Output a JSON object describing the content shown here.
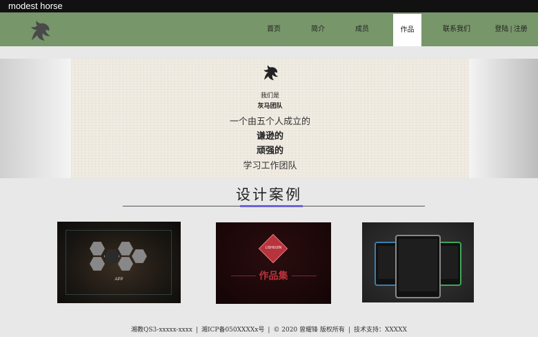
{
  "topbar": {
    "brand": "modest horse"
  },
  "nav": {
    "items": [
      "首页",
      "简介",
      "成员",
      "作品",
      "联系我们"
    ],
    "active": "作品",
    "login": "登陆",
    "sep": "|",
    "register": "注册"
  },
  "banner": {
    "line1": "我们是",
    "line2": "灰马团队",
    "line3": "一个由五个人成立的",
    "line4": "谦逊的",
    "line5": "顽强的",
    "line6": "学习工作团队"
  },
  "section": {
    "title": "设计案例"
  },
  "cards": {
    "app_label": "APP",
    "card2_diamond_text": "LISHUIJIN",
    "card2_title": "作品集"
  },
  "footer": {
    "item1": "湘教QS3-xxxxx-xxxx",
    "item2": "湘ICP备050XXXXx号",
    "item3": "© 2020 曾耀锋 版权所有",
    "item4": "技术支持：XXXXX",
    "sep": "|"
  },
  "colors": {
    "nav_bg": "#77966a",
    "accent": "#6a63d8",
    "topbar_bg": "#111111"
  }
}
